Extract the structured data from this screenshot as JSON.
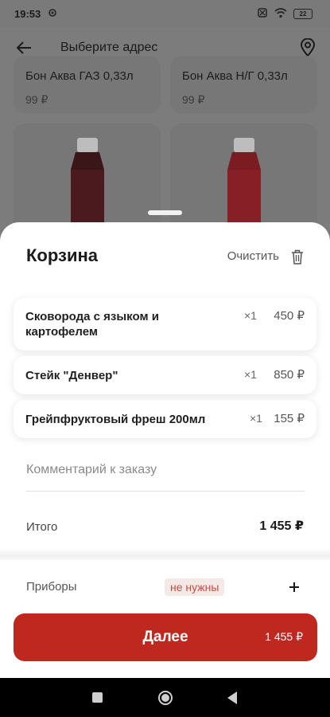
{
  "status_bar": {
    "time": "19:53",
    "battery": "22"
  },
  "header": {
    "title": "Выберите адрес"
  },
  "background_products": [
    {
      "name": "Бон Аква ГАЗ 0,33л",
      "price": "99 ₽"
    },
    {
      "name": "Бон Аква Н/Г 0,33л",
      "price": "99 ₽"
    }
  ],
  "cart": {
    "title": "Корзина",
    "clear_label": "Очистить",
    "items": [
      {
        "name": "Сковорода с языком и картофелем",
        "qty": "×1",
        "price": "450 ₽"
      },
      {
        "name": "Стейк \"Денвер\"",
        "qty": "×1",
        "price": "850 ₽"
      },
      {
        "name": "Грейпфруктовый фреш 200мл",
        "qty": "×1",
        "price": "155 ₽"
      }
    ],
    "comment_placeholder": "Комментарий к заказу",
    "total_label": "Итого",
    "total_value": "1 455 ₽",
    "cutlery_label": "Приборы",
    "cutlery_value": "не нужны",
    "next_label": "Далее",
    "next_total": "1 455 ₽"
  },
  "colors": {
    "accent": "#bf281f",
    "badge_text": "#cc4a3e",
    "badge_bg": "#f5e9e8"
  }
}
